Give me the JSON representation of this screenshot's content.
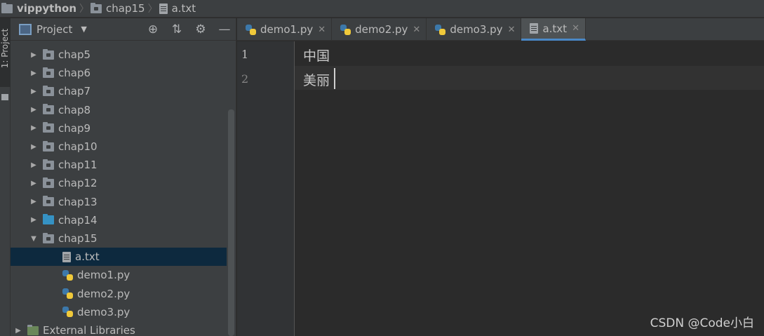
{
  "breadcrumb": {
    "root": "vippython",
    "folder": "chap15",
    "file": "a.txt"
  },
  "tool_strip": {
    "label": "1: Project"
  },
  "project_panel": {
    "title": "Project",
    "tools": [
      "locate-icon",
      "collapse-icon",
      "gear-icon",
      "minimize-icon"
    ],
    "tree": [
      {
        "label": "chap5",
        "type": "folder",
        "expanded": false
      },
      {
        "label": "chap6",
        "type": "folder",
        "expanded": false
      },
      {
        "label": "chap7",
        "type": "folder",
        "expanded": false
      },
      {
        "label": "chap8",
        "type": "folder",
        "expanded": false
      },
      {
        "label": "chap9",
        "type": "folder",
        "expanded": false
      },
      {
        "label": "chap10",
        "type": "folder",
        "expanded": false
      },
      {
        "label": "chap11",
        "type": "folder",
        "expanded": false
      },
      {
        "label": "chap12",
        "type": "folder",
        "expanded": false
      },
      {
        "label": "chap13",
        "type": "folder",
        "expanded": false
      },
      {
        "label": "chap14",
        "type": "folder-blue",
        "expanded": false
      },
      {
        "label": "chap15",
        "type": "folder",
        "expanded": true
      },
      {
        "label": "a.txt",
        "type": "txt",
        "selected": true
      },
      {
        "label": "demo1.py",
        "type": "py"
      },
      {
        "label": "demo2.py",
        "type": "py"
      },
      {
        "label": "demo3.py",
        "type": "py"
      },
      {
        "label": "External Libraries",
        "type": "libraries"
      }
    ]
  },
  "tabs": [
    {
      "label": "demo1.py",
      "type": "py",
      "active": false
    },
    {
      "label": "demo2.py",
      "type": "py",
      "active": false
    },
    {
      "label": "demo3.py",
      "type": "py",
      "active": false
    },
    {
      "label": "a.txt",
      "type": "txt",
      "active": true
    }
  ],
  "editor": {
    "lines": [
      {
        "number": "1",
        "text": "中国"
      },
      {
        "number": "2",
        "text": "美丽"
      }
    ],
    "current_line": 2
  },
  "watermark": "CSDN @Code小白",
  "colors": {
    "selection": "#0d293e",
    "tab_underline": "#4a88c7",
    "folder": "#8a9199",
    "folder_blue": "#3592c4"
  }
}
